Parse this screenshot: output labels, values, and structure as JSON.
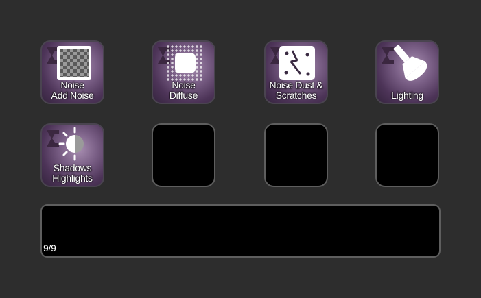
{
  "keys": [
    {
      "label_line1": "Noise",
      "label_line2": "Add Noise",
      "icon": "checkerboard-icon"
    },
    {
      "label_line1": "Noise",
      "label_line2": "Diffuse",
      "icon": "diffuse-icon"
    },
    {
      "label_line1": "Noise Dust &",
      "label_line2": "Scratches",
      "icon": "dust-scratches-icon"
    },
    {
      "label_line1": "",
      "label_line2": "Lighting",
      "icon": "flashlight-icon"
    },
    {
      "label_line1": "Shadows",
      "label_line2": "Highlights",
      "icon": "shadows-highlights-icon"
    }
  ],
  "footer": {
    "page_indicator": "9/9"
  },
  "colors": {
    "background": "#2d2d2d",
    "key_border": "#5e5e5e",
    "key_action_gradient": [
      "#a98fb2",
      "#7a5f86",
      "#4d3458",
      "#35243e"
    ],
    "badge": "#3b2740"
  }
}
